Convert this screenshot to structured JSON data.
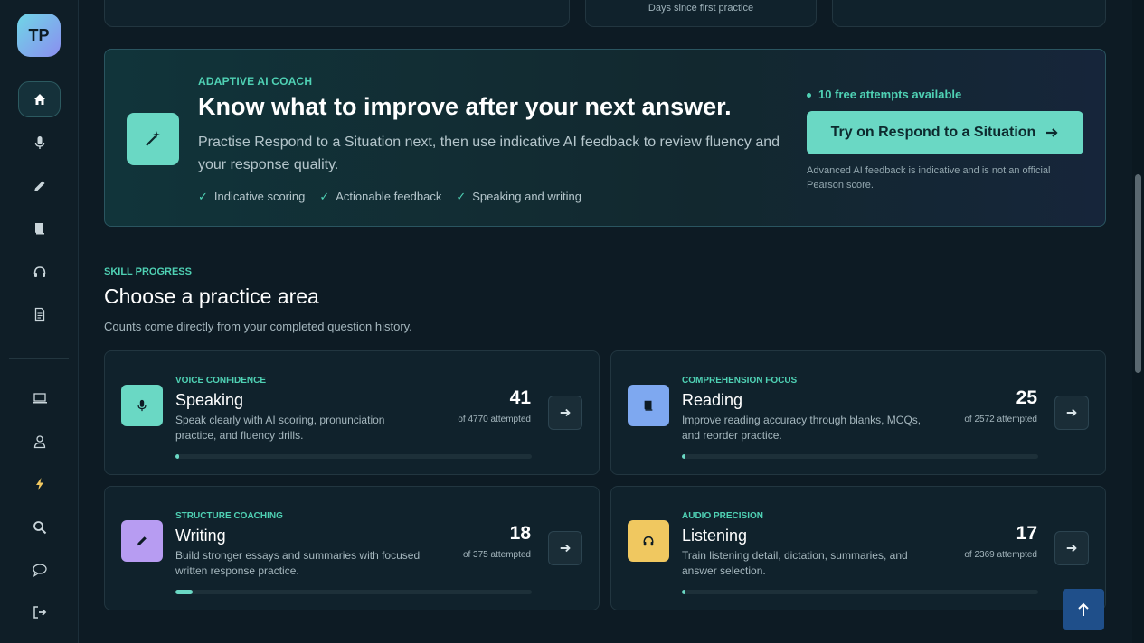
{
  "user": {
    "initials": "TP"
  },
  "sidebar": {
    "items": [
      {
        "name": "home-icon"
      },
      {
        "name": "mic-icon"
      },
      {
        "name": "pencil-icon"
      },
      {
        "name": "book-icon"
      },
      {
        "name": "headphones-icon"
      },
      {
        "name": "document-icon"
      },
      {
        "name": "laptop-icon"
      },
      {
        "name": "user-icon"
      },
      {
        "name": "lightning-icon"
      },
      {
        "name": "search-icon"
      },
      {
        "name": "chat-icon"
      },
      {
        "name": "logout-icon"
      }
    ]
  },
  "top": {
    "days_caption": "Days since first practice"
  },
  "coach": {
    "eyebrow": "ADAPTIVE AI COACH",
    "title": "Know what to improve after your next answer.",
    "description": "Practise Respond to a Situation next, then use indicative AI feedback to review fluency and your response quality.",
    "checks": [
      "Indicative scoring",
      "Actionable feedback",
      "Speaking and writing"
    ],
    "free_attempts": "10 free attempts available",
    "cta_label": "Try on Respond to a Situation",
    "disclaimer": "Advanced AI feedback is indicative and is not an official Pearson score."
  },
  "skills": {
    "eyebrow": "SKILL PROGRESS",
    "title": "Choose a practice area",
    "subtitle": "Counts come directly from your completed question history.",
    "cards": [
      {
        "eyebrow": "VOICE CONFIDENCE",
        "title": "Speaking",
        "description": "Speak clearly with AI scoring, pronunciation practice, and fluency drills.",
        "count": "41",
        "of": "of 4770 attempted",
        "progress": 0.0086,
        "icon": "mic-icon",
        "color": "#6ad8c4"
      },
      {
        "eyebrow": "COMPREHENSION FOCUS",
        "title": "Reading",
        "description": "Improve reading accuracy through blanks, MCQs, and reorder practice.",
        "count": "25",
        "of": "of 2572 attempted",
        "progress": 0.0097,
        "icon": "book-icon",
        "color": "#7ea8f0"
      },
      {
        "eyebrow": "STRUCTURE COACHING",
        "title": "Writing",
        "description": "Build stronger essays and summaries with focused written response practice.",
        "count": "18",
        "of": "of 375 attempted",
        "progress": 0.048,
        "icon": "pencil-icon",
        "color": "#b79cf2"
      },
      {
        "eyebrow": "AUDIO PRECISION",
        "title": "Listening",
        "description": "Train listening detail, dictation, summaries, and answer selection.",
        "count": "17",
        "of": "of 2369 attempted",
        "progress": 0.0072,
        "icon": "headphones-icon",
        "color": "#f0c860"
      }
    ]
  }
}
